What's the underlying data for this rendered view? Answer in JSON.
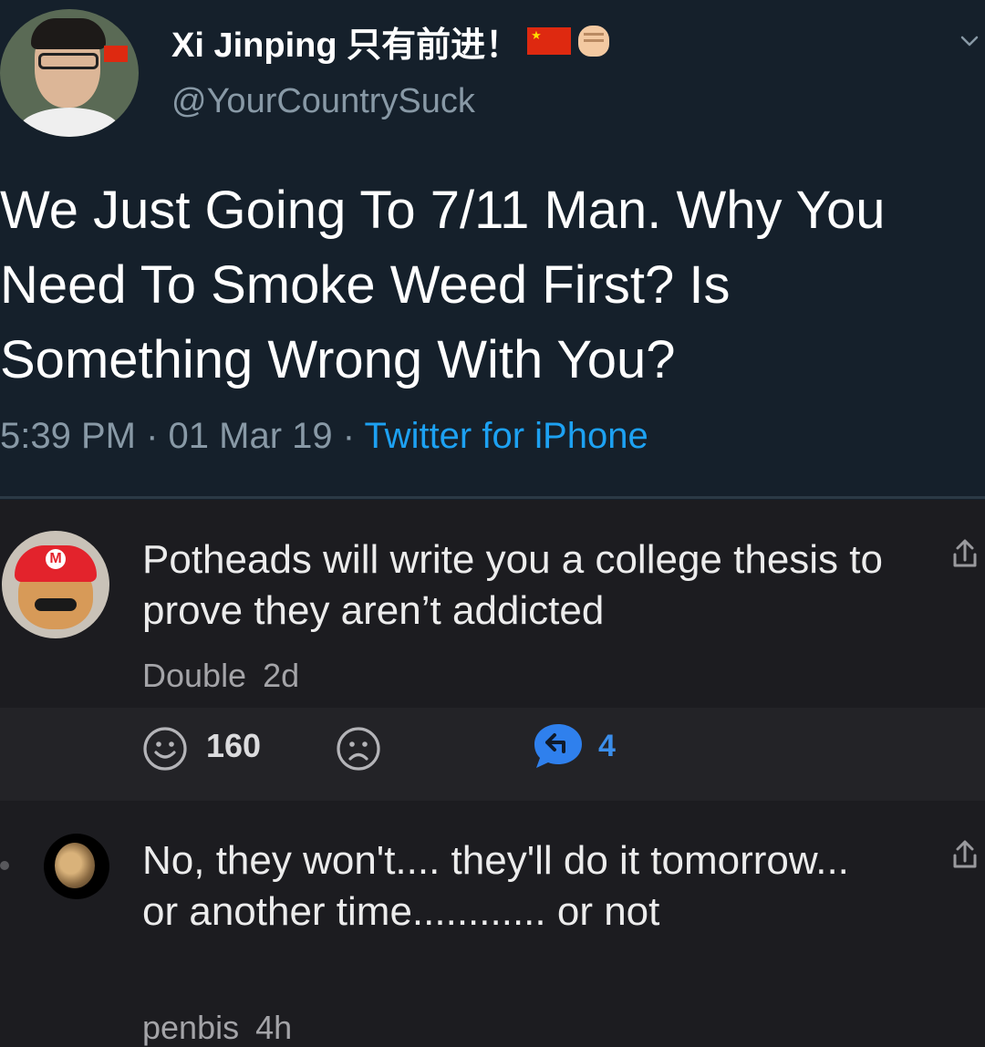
{
  "tweet": {
    "display_name": "Xi Jinping 只有前进！",
    "handle": "@YourCountrySuck",
    "text": "We Just Going To 7/11 Man. Why You Need To Smoke Weed First? Is Something Wrong With You?",
    "time": "5:39 PM",
    "date": "01 Mar 19",
    "sep": " · ",
    "source": "Twitter for iPhone",
    "icons": [
      "china-flag-icon",
      "raised-fist-icon",
      "chevron-down-icon"
    ]
  },
  "comments": [
    {
      "text": "Potheads will write you a college thesis to prove they aren’t addicted",
      "author": "Double",
      "age": "2d",
      "likes": "160",
      "replies": "4"
    },
    {
      "text": "No, they won't.... they'll do it tomorrow... or another time............ or not",
      "author": "penbis",
      "age": "4h"
    }
  ],
  "colors": {
    "tweet_background": "#15202b",
    "page_background": "#1c1c20",
    "action_bar": "#232327",
    "link_blue": "#1da1f2",
    "reply_blue": "#2f80ed"
  }
}
